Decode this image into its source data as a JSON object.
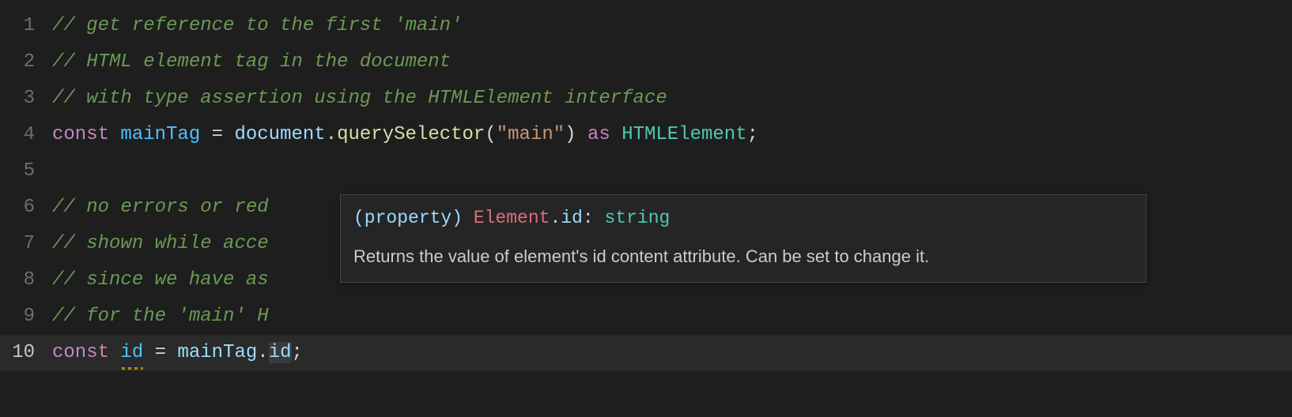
{
  "lines": [
    {
      "num": "1",
      "tokens": [
        {
          "cls": "tk-comment",
          "t": "// get reference to the first 'main'"
        }
      ]
    },
    {
      "num": "2",
      "tokens": [
        {
          "cls": "tk-comment",
          "t": "// HTML element tag in the document"
        }
      ]
    },
    {
      "num": "3",
      "tokens": [
        {
          "cls": "tk-comment",
          "t": "// with type assertion using the HTMLElement interface"
        }
      ]
    },
    {
      "num": "4",
      "tokens": [
        {
          "cls": "tk-keyword",
          "t": "const"
        },
        {
          "cls": "tk-punc",
          "t": " "
        },
        {
          "cls": "tk-const",
          "t": "mainTag"
        },
        {
          "cls": "tk-punc",
          "t": " "
        },
        {
          "cls": "tk-op",
          "t": "="
        },
        {
          "cls": "tk-punc",
          "t": " "
        },
        {
          "cls": "tk-obj",
          "t": "document"
        },
        {
          "cls": "tk-punc",
          "t": "."
        },
        {
          "cls": "tk-func",
          "t": "querySelector"
        },
        {
          "cls": "tk-punc",
          "t": "("
        },
        {
          "cls": "tk-str",
          "t": "\"main\""
        },
        {
          "cls": "tk-punc",
          "t": ") "
        },
        {
          "cls": "tk-keyword",
          "t": "as"
        },
        {
          "cls": "tk-punc",
          "t": " "
        },
        {
          "cls": "tk-type",
          "t": "HTMLElement"
        },
        {
          "cls": "tk-punc",
          "t": ";"
        }
      ]
    },
    {
      "num": "5",
      "tokens": []
    },
    {
      "num": "6",
      "tokens": [
        {
          "cls": "tk-comment",
          "t": "// no errors or red"
        }
      ]
    },
    {
      "num": "7",
      "tokens": [
        {
          "cls": "tk-comment",
          "t": "// shown while acce"
        }
      ]
    },
    {
      "num": "8",
      "tokens": [
        {
          "cls": "tk-comment",
          "t": "// since we have as"
        }
      ]
    },
    {
      "num": "9",
      "tokens": [
        {
          "cls": "tk-comment",
          "t": "// for the 'main' H"
        }
      ]
    },
    {
      "num": "10",
      "active": true,
      "tokens": [
        {
          "cls": "tk-keyword",
          "t": "const"
        },
        {
          "cls": "tk-punc",
          "t": " "
        },
        {
          "cls": "tk-const squiggle",
          "t": "id"
        },
        {
          "cls": "tk-punc",
          "t": " "
        },
        {
          "cls": "tk-op",
          "t": "="
        },
        {
          "cls": "tk-punc",
          "t": " "
        },
        {
          "cls": "tk-obj",
          "t": "mainTag"
        },
        {
          "cls": "tk-punc",
          "t": "."
        },
        {
          "cls": "tk-prop wordhl",
          "t": "id"
        },
        {
          "cls": "tk-punc",
          "t": ";"
        }
      ]
    }
  ],
  "hover": {
    "sig": {
      "prefix": "(property) ",
      "class": "Element",
      "dot": ".",
      "prop": "id",
      "colon": ": ",
      "type": "string"
    },
    "doc": "Returns the value of element's id content attribute. Can be set to change it."
  }
}
